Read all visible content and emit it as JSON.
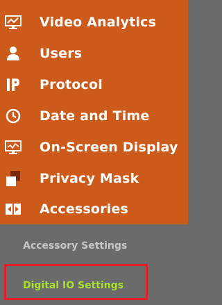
{
  "menu": {
    "items": [
      {
        "label": "Video Analytics",
        "icon": "video-analytics-icon"
      },
      {
        "label": "Users",
        "icon": "user-icon"
      },
      {
        "label": "Protocol",
        "icon": "ip-icon"
      },
      {
        "label": "Date and Time",
        "icon": "clock-icon"
      },
      {
        "label": "On-Screen Display",
        "icon": "monitor-icon"
      },
      {
        "label": "Privacy Mask",
        "icon": "privacy-mask-icon"
      },
      {
        "label": "Accessories",
        "icon": "accessories-icon"
      }
    ]
  },
  "submenu": {
    "items": [
      {
        "label": "Accessory Settings"
      },
      {
        "label": "Digital IO Settings"
      }
    ]
  },
  "colors": {
    "menu_bg": "#cc5a1a",
    "submenu_bg": "#6b6b6b",
    "submenu_text": "#c6c6c6",
    "active_text": "#a9e030",
    "highlight": "#e01f26"
  }
}
